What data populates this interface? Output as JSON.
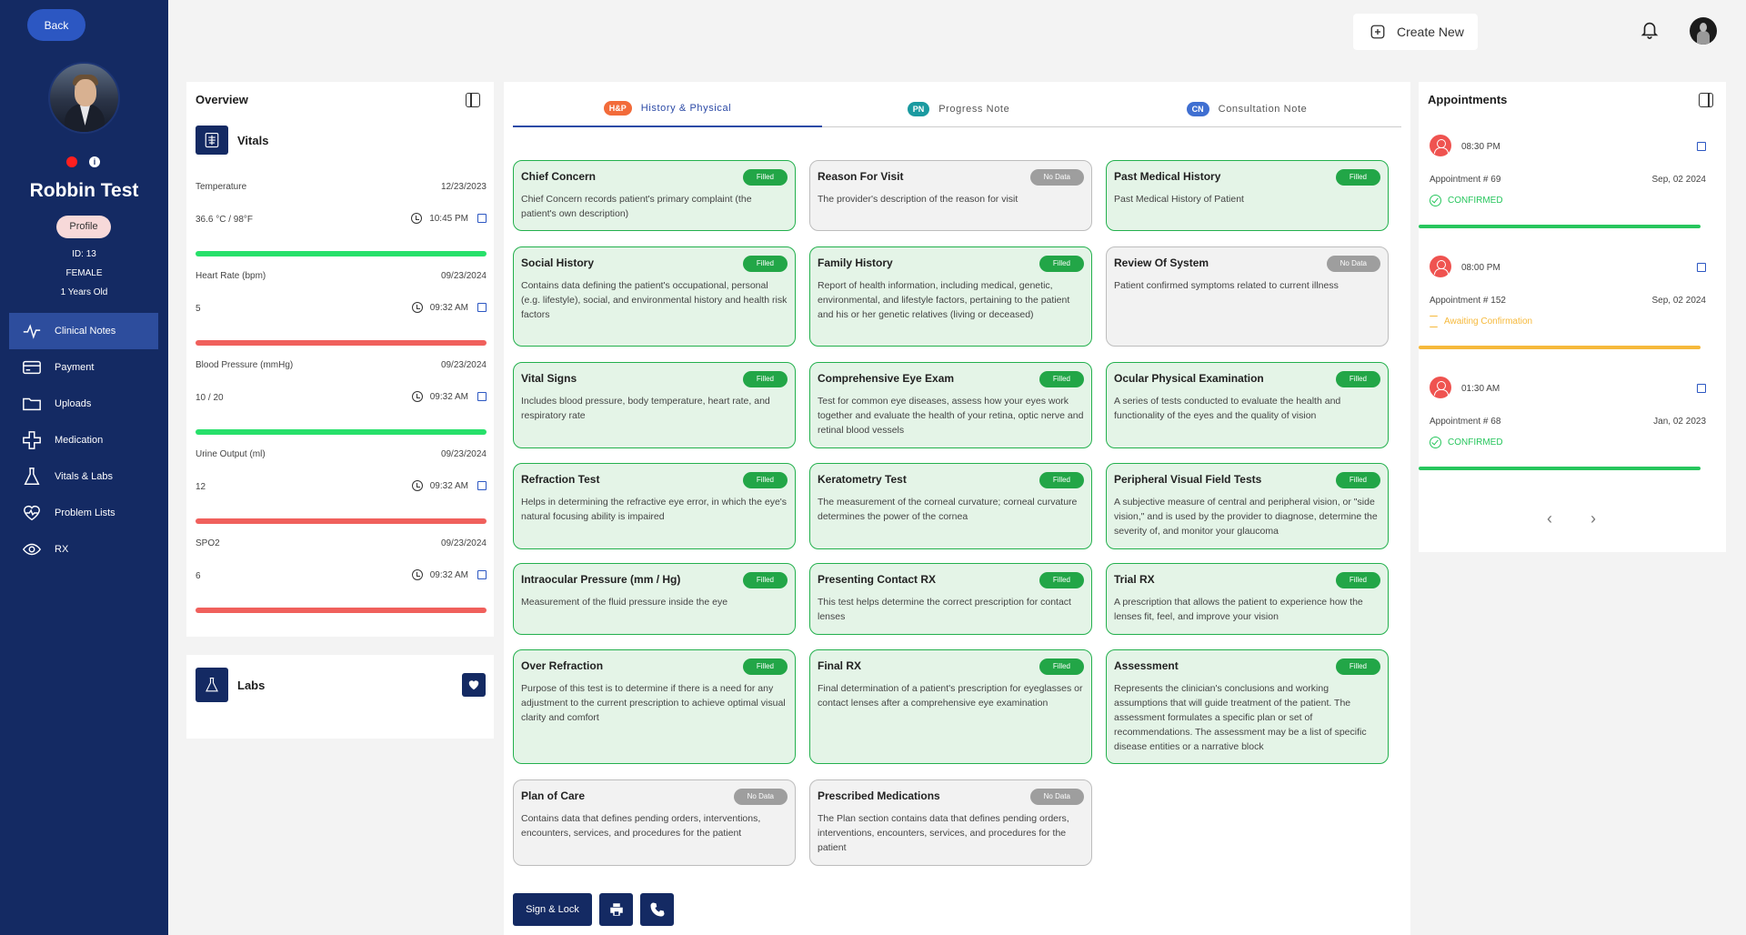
{
  "sidebar": {
    "back_label": "Back",
    "patient_name": "Robbin Test",
    "profile_label": "Profile",
    "patient_id": "ID: 13",
    "gender": "FEMALE",
    "age": "1 Years Old",
    "nav": [
      {
        "label": "Clinical Notes",
        "icon": "pulse-icon",
        "active": true
      },
      {
        "label": "Payment",
        "icon": "card-icon",
        "active": false
      },
      {
        "label": "Uploads",
        "icon": "folder-icon",
        "active": false
      },
      {
        "label": "Medication",
        "icon": "plus-cross-icon",
        "active": false
      },
      {
        "label": "Vitals & Labs",
        "icon": "flask-icon",
        "active": false
      },
      {
        "label": "Problem Lists",
        "icon": "heart-pulse-icon",
        "active": false
      },
      {
        "label": "RX",
        "icon": "eye-icon",
        "active": false
      }
    ]
  },
  "header": {
    "create_label": "Create New"
  },
  "overview": {
    "title": "Overview",
    "vitals_title": "Vitals",
    "vitals": [
      {
        "label": "Temperature",
        "date": "12/23/2023",
        "value": "36.6 °C / 98°F",
        "time": "10:45 PM",
        "status_color": "#27e06a"
      },
      {
        "label": "Heart Rate (bpm)",
        "date": "09/23/2024",
        "value": "5",
        "time": "09:32 AM",
        "status_color": "#f0605c"
      },
      {
        "label": "Blood Pressure (mmHg)",
        "date": "09/23/2024",
        "value": "10 / 20",
        "time": "09:32 AM",
        "status_color": "#27e06a"
      },
      {
        "label": "Urine Output (ml)",
        "date": "09/23/2024",
        "value": "12",
        "time": "09:32 AM",
        "status_color": "#f0605c"
      },
      {
        "label": "SPO2",
        "date": "09/23/2024",
        "value": "6",
        "time": "09:32 AM",
        "status_color": "#f0605c"
      }
    ],
    "labs_title": "Labs"
  },
  "tabs": [
    {
      "badge": "H&P",
      "label": "History & Physical",
      "badge_color": "#f26b3a",
      "active": true
    },
    {
      "badge": "PN",
      "label": "Progress Note",
      "badge_color": "#1a9aa0",
      "active": false
    },
    {
      "badge": "CN",
      "label": "Consultation Note",
      "badge_color": "#3f6fd1",
      "active": false
    }
  ],
  "cards": [
    {
      "title": "Chief Concern",
      "status": "Filled",
      "desc": "Chief Concern records patient's primary complaint (the patient's own description)"
    },
    {
      "title": "Reason For Visit",
      "status": "No Data",
      "desc": "The provider's description of the reason for visit"
    },
    {
      "title": "Past Medical History",
      "status": "Filled",
      "desc": "Past Medical History of Patient"
    },
    {
      "title": "Social History",
      "status": "Filled",
      "desc": "Contains data defining the patient's occupational, personal (e.g. lifestyle), social, and environmental history and health risk factors"
    },
    {
      "title": "Family History",
      "status": "Filled",
      "desc": "Report of health information, including medical, genetic, environmental, and lifestyle factors, pertaining to the patient and his or her genetic relatives (living or deceased)"
    },
    {
      "title": "Review Of System",
      "status": "No Data",
      "desc": "Patient confirmed symptoms related to current illness"
    },
    {
      "title": "Vital Signs",
      "status": "Filled",
      "desc": "Includes blood pressure, body temperature, heart rate, and respiratory rate"
    },
    {
      "title": "Comprehensive Eye Exam",
      "status": "Filled",
      "desc": "Test for common eye diseases, assess how your eyes work together and evaluate the health of your retina, optic nerve and retinal blood vessels"
    },
    {
      "title": "Ocular Physical Examination",
      "status": "Filled",
      "desc": "A series of tests conducted to evaluate the health and functionality of the eyes and the quality of vision"
    },
    {
      "title": "Refraction Test",
      "status": "Filled",
      "desc": "Helps in determining the refractive eye error, in which the eye's natural focusing ability is impaired"
    },
    {
      "title": "Keratometry Test",
      "status": "Filled",
      "desc": "The measurement of the corneal curvature; corneal curvature determines the power of the cornea"
    },
    {
      "title": "Peripheral Visual Field Tests",
      "status": "Filled",
      "desc": "A subjective measure of central and peripheral vision, or \"side vision,\" and is used by the provider to diagnose, determine the severity of, and monitor your glaucoma"
    },
    {
      "title": "Intraocular Pressure (mm / Hg)",
      "status": "Filled",
      "desc": "Measurement of the fluid pressure inside the eye"
    },
    {
      "title": "Presenting Contact RX",
      "status": "Filled",
      "desc": "This test helps determine the correct prescription for contact lenses"
    },
    {
      "title": "Trial RX",
      "status": "Filled",
      "desc": "A prescription that allows the patient to experience how the lenses fit, feel, and improve your vision"
    },
    {
      "title": "Over Refraction",
      "status": "Filled",
      "desc": "Purpose of this test is to determine if there is a need for any adjustment to the current prescription to achieve optimal visual clarity and comfort"
    },
    {
      "title": "Final RX",
      "status": "Filled",
      "desc": "Final determination of a patient's prescription for eyeglasses or contact lenses after a comprehensive eye examination"
    },
    {
      "title": "Assessment",
      "status": "Filled",
      "desc": "Represents the clinician's conclusions and working assumptions that will guide treatment of the patient. The assessment formulates a specific plan or set of recommendations. The assessment may be a list of specific disease entities or a narrative block"
    },
    {
      "title": "Plan of Care",
      "status": "No Data",
      "desc": "Contains data that defines pending orders, interventions, encounters, services, and procedures for the patient"
    },
    {
      "title": "Prescribed Medications",
      "status": "No Data",
      "desc": "The Plan section contains data that defines pending orders, interventions, encounters, services, and procedures for the patient"
    }
  ],
  "actions": {
    "sign_lock_label": "Sign & Lock"
  },
  "appointments": {
    "title": "Appointments",
    "items": [
      {
        "time": "08:30 PM",
        "number": "Appointment # 69",
        "date": "Sep, 02 2024",
        "status": "CONFIRMED",
        "status_color": "#27c65d"
      },
      {
        "time": "08:00 PM",
        "number": "Appointment # 152",
        "date": "Sep, 02 2024",
        "status": "Awaiting Confirmation",
        "status_color": "#f6b93b"
      },
      {
        "time": "01:30 AM",
        "number": "Appointment # 68",
        "date": "Jan, 02 2023",
        "status": "CONFIRMED",
        "status_color": "#27c65d"
      }
    ],
    "prev_glyph": "‹",
    "next_glyph": "›"
  },
  "colors": {
    "sidebar_bg": "#142a63",
    "accent": "#2c57c2",
    "filled_green": "#22a647",
    "nodata_gray": "#9e9e9e"
  }
}
